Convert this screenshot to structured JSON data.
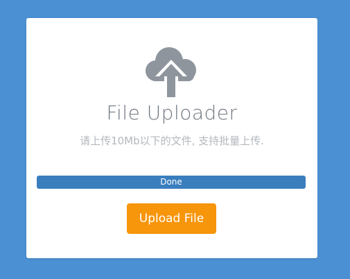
{
  "uploader": {
    "icon": "cloud-upload-icon",
    "title": "File Uploader",
    "subtitle": "请上传10Mb以下的文件, 支持批量上传.",
    "progress": {
      "percent": 100,
      "label": "Done"
    },
    "upload_button_label": "Upload File"
  },
  "colors": {
    "background": "#4a90d2",
    "card": "#ffffff",
    "icon": "#8f959c",
    "title": "#6f7780",
    "subtitle": "#b3b7bd",
    "progress_fill": "#3a7ebe",
    "button": "#f7950b"
  }
}
